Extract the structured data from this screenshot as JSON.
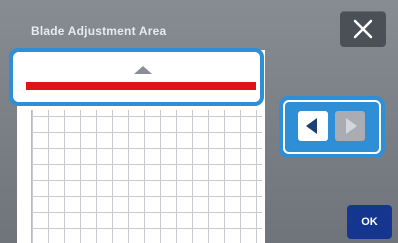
{
  "dialog": {
    "title": "Blade Adjustment Area",
    "ok_label": "OK"
  },
  "icons": {
    "close": "close-icon",
    "up": "up-arrow-icon",
    "left": "left-arrow-icon",
    "right": "right-arrow-icon"
  },
  "colors": {
    "accent_focus": "#2f8fd6",
    "blade_line": "#e01414",
    "ok_button": "#14368f",
    "background": "#7a7f86"
  },
  "state": {
    "left_arrow_enabled": true,
    "right_arrow_enabled": false
  }
}
